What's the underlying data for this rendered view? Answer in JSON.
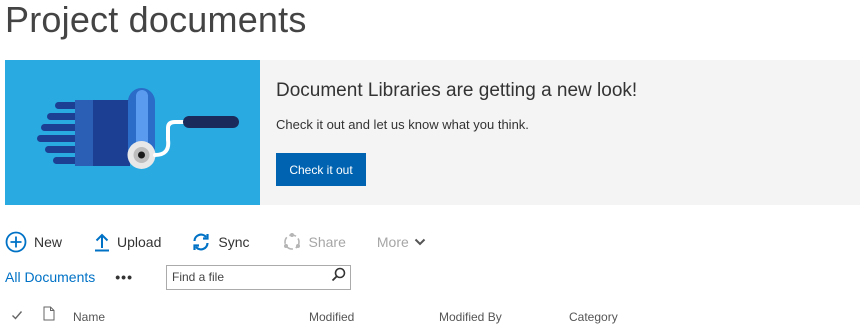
{
  "page": {
    "title": "Project documents"
  },
  "banner": {
    "title": "Document Libraries are getting a new look!",
    "description": "Check it out and let us know what you think.",
    "button_label": "Check it out",
    "art_background": "#29abe2",
    "button_color": "#0063b1"
  },
  "commands": {
    "new_label": "New",
    "upload_label": "Upload",
    "sync_label": "Sync",
    "share_label": "Share",
    "more_label": "More"
  },
  "views": {
    "current_view": "All Documents",
    "ellipsis": "•••",
    "search_placeholder": "Find a file"
  },
  "columns": {
    "name": "Name",
    "modified": "Modified",
    "modified_by": "Modified By",
    "category": "Category"
  },
  "icons": {
    "new": "plus-circle-icon",
    "upload": "upload-arrow-icon",
    "sync": "sync-icon",
    "share": "share-icon",
    "more": "chevron-down-icon",
    "search": "search-icon",
    "select": "checkmark-icon",
    "file_type": "document-icon",
    "banner_art": "paint-roller-illustration"
  },
  "colors": {
    "accent": "#0072c6",
    "disabled": "#a6a6a6"
  }
}
